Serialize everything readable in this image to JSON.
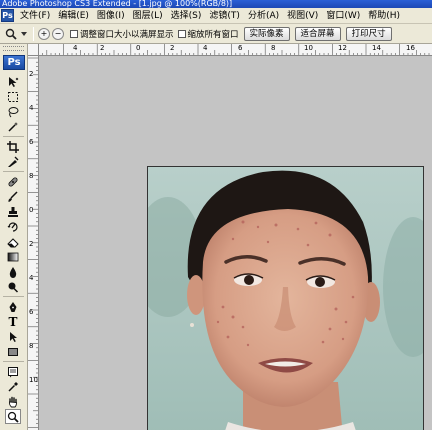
{
  "app": {
    "title": "Adobe Photoshop CS3 Extended - [1.jpg @ 100%(RGB/8)]",
    "logo_text": "Ps",
    "icon_text": "Ps"
  },
  "menu": [
    {
      "label": "文件(F)"
    },
    {
      "label": "编辑(E)"
    },
    {
      "label": "图像(I)"
    },
    {
      "label": "图层(L)"
    },
    {
      "label": "选择(S)"
    },
    {
      "label": "滤镜(T)"
    },
    {
      "label": "分析(A)"
    },
    {
      "label": "视图(V)"
    },
    {
      "label": "窗口(W)"
    },
    {
      "label": "帮助(H)"
    }
  ],
  "options": {
    "zoom_in_symbol": "+",
    "zoom_out_symbol": "−",
    "resize_windows_label": "调整窗口大小以满屏显示",
    "zoom_all_windows_label": "缩放所有窗口",
    "actual_pixels_label": "实际像素",
    "fit_screen_label": "适合屏幕",
    "print_size_label": "打印尺寸"
  },
  "ruler": {
    "top_ticks": [
      "4",
      "2",
      "0",
      "2",
      "4",
      "6",
      "8",
      "10",
      "12",
      "14",
      "16"
    ],
    "left_ticks": [
      "2",
      "4",
      "6",
      "8",
      "0",
      "2",
      "4",
      "6",
      "8",
      "10"
    ]
  },
  "tools": [
    {
      "name": "move-tool",
      "icon": "move-icon"
    },
    {
      "name": "marquee-tool",
      "icon": "marquee-icon"
    },
    {
      "name": "lasso-tool",
      "icon": "lasso-icon"
    },
    {
      "name": "quick-selection-tool",
      "icon": "magic-wand-icon"
    },
    {
      "name": "crop-tool",
      "icon": "crop-icon"
    },
    {
      "name": "eyedropper-slice-tool",
      "icon": "slice-icon"
    },
    {
      "name": "healing-brush-tool",
      "icon": "bandage-icon"
    },
    {
      "name": "brush-tool",
      "icon": "brush-icon"
    },
    {
      "name": "clone-stamp-tool",
      "icon": "stamp-icon"
    },
    {
      "name": "history-brush-tool",
      "icon": "history-brush-icon"
    },
    {
      "name": "eraser-tool",
      "icon": "eraser-icon"
    },
    {
      "name": "gradient-tool",
      "icon": "gradient-icon"
    },
    {
      "name": "blur-tool",
      "icon": "blur-icon"
    },
    {
      "name": "dodge-tool",
      "icon": "dodge-icon"
    },
    {
      "name": "pen-tool",
      "icon": "pen-icon"
    },
    {
      "name": "type-tool",
      "icon": "type-icon",
      "glyph": "T"
    },
    {
      "name": "path-selection-tool",
      "icon": "arrow-icon"
    },
    {
      "name": "shape-tool",
      "icon": "rectangle-icon"
    },
    {
      "name": "notes-tool",
      "icon": "notes-icon"
    },
    {
      "name": "eyedropper-tool",
      "icon": "eyedropper-icon"
    },
    {
      "name": "hand-tool",
      "icon": "hand-icon"
    },
    {
      "name": "zoom-tool",
      "icon": "zoom-icon"
    }
  ],
  "colors": {
    "workspace": "#c4c4c4",
    "panel": "#ece9d8",
    "titlebar": "#2a5fd6"
  }
}
